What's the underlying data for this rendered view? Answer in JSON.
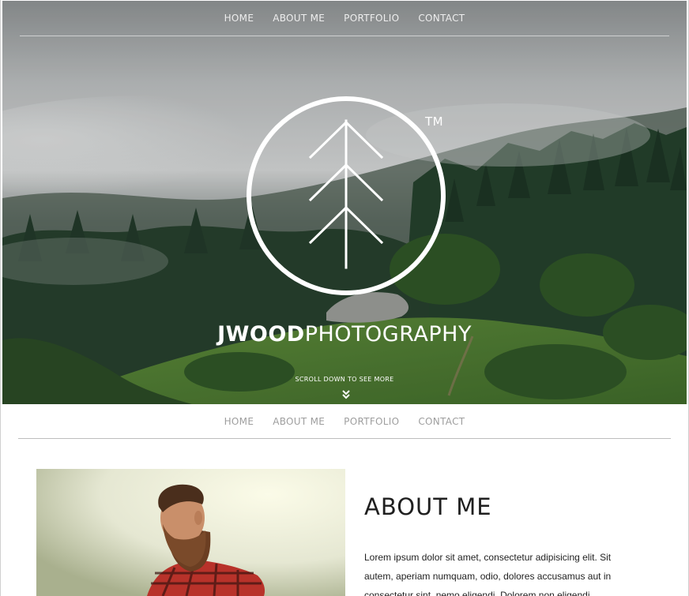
{
  "nav": {
    "home": "HOME",
    "about": "ABOUT ME",
    "portfolio": "PORTFOLIO",
    "contact": "CONTACT"
  },
  "hero": {
    "trademark": "TM",
    "brand_strong": "JWOOD",
    "brand_light": "PHOTOGRAPHY",
    "scroll_hint": "SCROLL DOWN TO SEE MORE",
    "background": "misty-forest-hillside-photo",
    "logo": "tree-in-circle-logo"
  },
  "about": {
    "title": "ABOUT ME",
    "body": "Lorem ipsum dolor sit amet, consectetur adipisicing elit. Sit autem, aperiam numquam, odio, dolores accusamus aut in consectetur sint, nemo eligendi. Dolorem non eligendi",
    "portrait": "bearded-man-in-plaid-shirt-photo"
  },
  "colors": {
    "accent_text": "#ffffff",
    "nav_gray": "#9e9e9e",
    "rule_gray": "#bdbdbd",
    "heading": "#1f1f1f"
  }
}
